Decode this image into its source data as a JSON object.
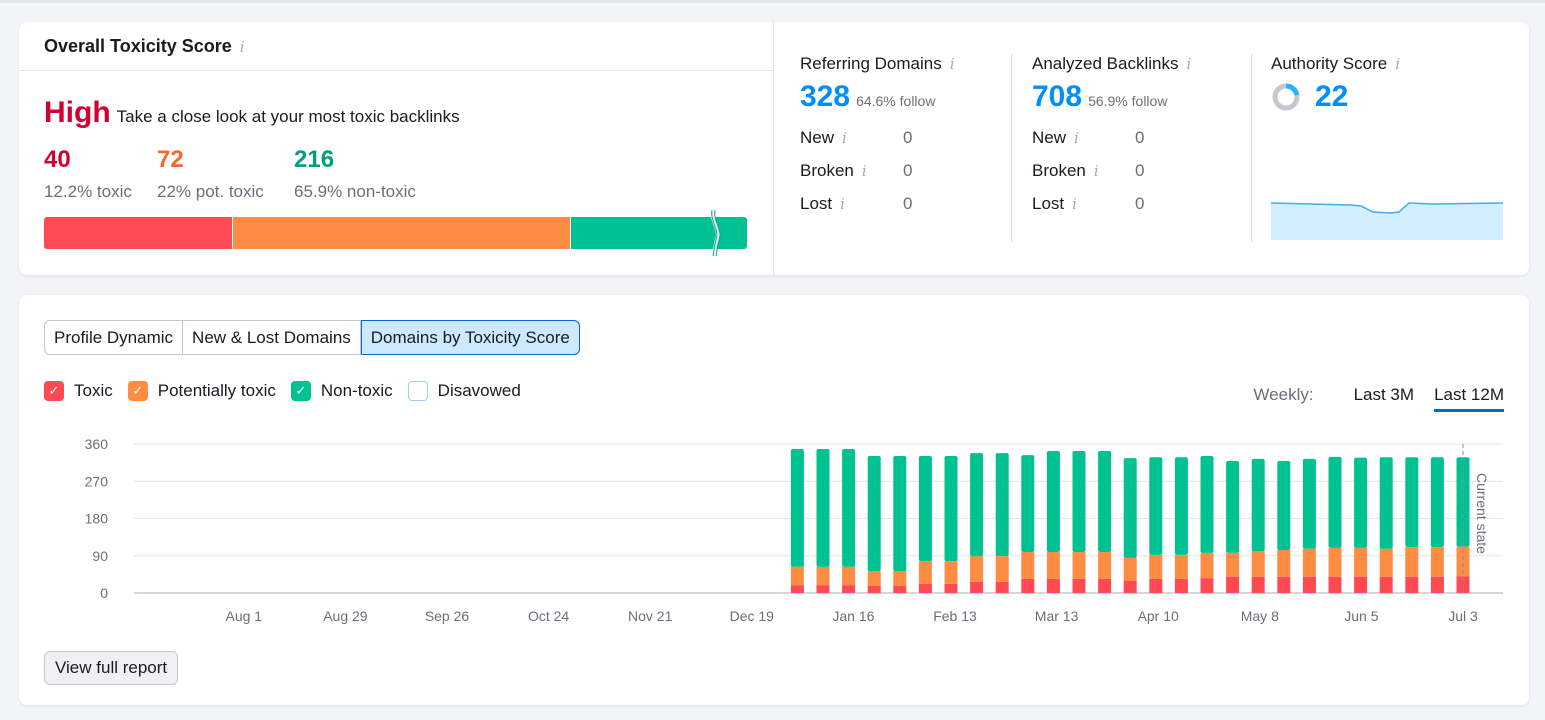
{
  "toxicity": {
    "title": "Overall Toxicity Score",
    "level": "High",
    "level_desc": "Take a close look at your most toxic backlinks",
    "counts": [
      {
        "value": "40",
        "label": "12.2% toxic",
        "color": "#d1002f"
      },
      {
        "value": "72",
        "label": "22% pot. toxic",
        "color": "#ff642d"
      },
      {
        "value": "216",
        "label": "65.9% non-toxic",
        "color": "#009f81"
      }
    ],
    "bar": [
      {
        "name": "toxic",
        "percent": 12.2,
        "color": "#ff4953"
      },
      {
        "name": "potentially-toxic",
        "percent": 22,
        "color": "#ff8c43"
      },
      {
        "name": "non-toxic",
        "percent": 65.9,
        "color": "#00c192"
      }
    ]
  },
  "metrics": {
    "referring_domains": {
      "title": "Referring Domains",
      "value": "328",
      "sub": "64.6% follow",
      "rows": [
        {
          "label": "New",
          "value": "0"
        },
        {
          "label": "Broken",
          "value": "0"
        },
        {
          "label": "Lost",
          "value": "0"
        }
      ]
    },
    "analyzed_backlinks": {
      "title": "Analyzed Backlinks",
      "value": "708",
      "sub": "56.9% follow",
      "rows": [
        {
          "label": "New",
          "value": "0"
        },
        {
          "label": "Broken",
          "value": "0"
        },
        {
          "label": "Lost",
          "value": "0"
        }
      ]
    },
    "authority_score": {
      "title": "Authority Score",
      "value": "22",
      "donut_fraction": 0.22
    }
  },
  "tabs": [
    {
      "label": "Profile Dynamic",
      "active": false
    },
    {
      "label": "New & Lost Domains",
      "active": false
    },
    {
      "label": "Domains by Toxicity Score",
      "active": true
    }
  ],
  "legend": [
    {
      "label": "Toxic",
      "checked": true,
      "color": "#ff4953"
    },
    {
      "label": "Potentially toxic",
      "checked": true,
      "color": "#ff8c43"
    },
    {
      "label": "Non-toxic",
      "checked": true,
      "color": "#00c192"
    },
    {
      "label": "Disavowed",
      "checked": false,
      "color": "#ffffff"
    }
  ],
  "period": {
    "label": "Weekly:",
    "options": [
      {
        "label": "Last 3M",
        "active": false
      },
      {
        "label": "Last 12M",
        "active": true
      }
    ]
  },
  "view_full_report": "View full report",
  "chart_data": {
    "type": "bar",
    "stacked": true,
    "ylim": [
      0,
      360
    ],
    "yticks": [
      0,
      90,
      180,
      270,
      360
    ],
    "x_labels": [
      "Aug 1",
      "Aug 29",
      "Sep 26",
      "Oct 24",
      "Nov 21",
      "Dec 19",
      "Jan 16",
      "Feb 13",
      "Mar 13",
      "Apr 10",
      "May 8",
      "Jun 5",
      "Jul 3"
    ],
    "weeks_total": 52,
    "first_data_week": 25,
    "annotation": "Current state",
    "series": [
      {
        "name": "Toxic",
        "color": "#ff4953",
        "values": [
          19,
          19,
          19,
          17,
          17,
          22,
          22,
          27,
          27,
          34,
          34,
          34,
          34,
          29,
          34,
          34,
          36,
          39,
          39,
          39,
          39,
          39,
          39,
          39,
          39,
          39,
          40
        ]
      },
      {
        "name": "Potentially toxic",
        "color": "#ff8c43",
        "values": [
          44,
          44,
          44,
          36,
          36,
          55,
          55,
          62,
          62,
          65,
          65,
          65,
          65,
          56,
          58,
          58,
          61,
          58,
          62,
          65,
          68,
          70,
          70,
          68,
          72,
          72,
          72
        ]
      },
      {
        "name": "Non-toxic",
        "color": "#00c192",
        "values": [
          285,
          285,
          285,
          278,
          278,
          254,
          254,
          249,
          249,
          234,
          244,
          244,
          244,
          241,
          236,
          236,
          234,
          222,
          223,
          215,
          217,
          220,
          218,
          221,
          217,
          217,
          216
        ]
      }
    ]
  }
}
